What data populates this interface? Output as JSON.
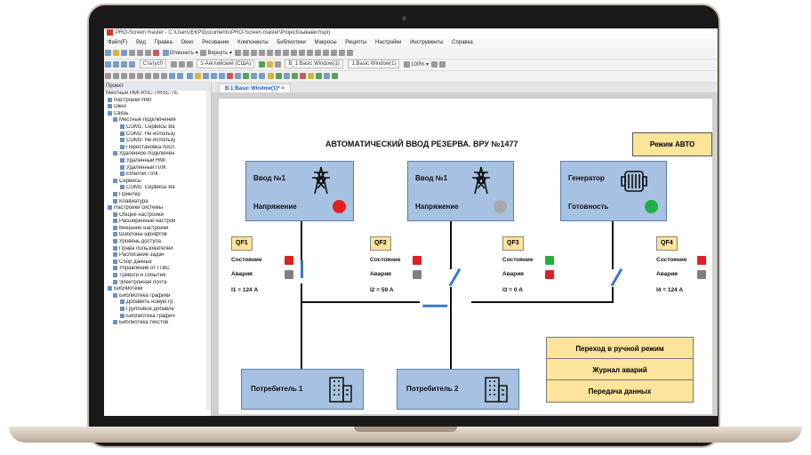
{
  "app": {
    "title": "PRO-Screen master - C:\\Users\\EKP\\Documents\\PRO-Screen master\\Projects\\ывави.hsprj",
    "menu": [
      "Файл(F)",
      "Вид",
      "Правка",
      "Окно",
      "Рисование",
      "Компоненты",
      "Библиотеки",
      "Макросы",
      "Рецепты",
      "Настройки",
      "Инструменты",
      "Справка"
    ],
    "toolbar1": {
      "undo": "Отменить",
      "redo": "Вернуть"
    },
    "toolbar2": {
      "state": "Статус0",
      "language": "1-Английский (США)",
      "window": "B_1:Basic Window(1)",
      "window2": "1:Basic Window(1)",
      "zoom": "100%"
    }
  },
  "tree": {
    "header": "Проект",
    "items": [
      "Местный HMI RSC-7/RSC-7E",
      "Настройки HMI",
      "Окно",
      "Связь",
      "Местные подключения",
      "COM1: Сервисы Ва",
      "COM2: Не использу",
      "COM3: Не использу",
      "Перестановка посл",
      "Удаленное подключен",
      "Удаленный HMI",
      "Удаленный ПЛК",
      "Ethernet ПЛК",
      "Сервисы",
      "COM1: Сервисы Ва",
      "Принтер",
      "Клавиатура",
      "Настройки системы",
      "Общие настройки",
      "Расширенные настрой",
      "Внешние настройки",
      "Шаблоны шрифтов",
      "Уровень доступа",
      "Права пользователей",
      "Расписание задач",
      "Сбор данных",
      "Управление от П.ВС",
      "Тревоги и события",
      "Электронная почта",
      "Библиотеки",
      "Библиотека графики",
      "Добавить новую гр",
      "Групповое добавле",
      "Библиотека графич",
      "Библиотека текстов"
    ]
  },
  "tab": {
    "label": "B 1:Basic Window(1)*",
    "close": "×"
  },
  "hmi": {
    "title": "АВТОМАТИЧЕСКИЙ ВВОД РЕЗЕРВА. ВРУ №1477",
    "mode": "Режим АВТО",
    "sources": [
      {
        "name": "Ввод №1",
        "label": "Напряжение",
        "lamp": "#e02020"
      },
      {
        "name": "Ввод №1",
        "label": "Напряжение",
        "lamp": "#a8a8a8"
      },
      {
        "name": "Генератор",
        "label": "Готовность",
        "lamp": "#22b040"
      }
    ],
    "breakers": [
      {
        "id": "QF1",
        "state_label": "Состояние",
        "state_color": "#e02020",
        "alarm_label": "Авария",
        "alarm_color": "#808080",
        "current": "I1 = 124 А"
      },
      {
        "id": "QF2",
        "state_label": "Состояние",
        "state_color": "#e02020",
        "alarm_label": "Авария",
        "alarm_color": "#808080",
        "current": "I2 = 59 А"
      },
      {
        "id": "QF3",
        "state_label": "Состояние",
        "state_color": "#22b040",
        "alarm_label": "Авария",
        "alarm_color": "#e02020",
        "current": "I3 = 0 А"
      },
      {
        "id": "QF4",
        "state_label": "Состояние",
        "state_color": "#e02020",
        "alarm_label": "Авария",
        "alarm_color": "#808080",
        "current": "I4 = 124 А"
      }
    ],
    "consumers": [
      "Потребитель 1",
      "Потребитель 2"
    ],
    "buttons": {
      "manual": "Переход в ручной режим",
      "journal": "Журнал аварий",
      "transfer": "Передача данных"
    }
  }
}
